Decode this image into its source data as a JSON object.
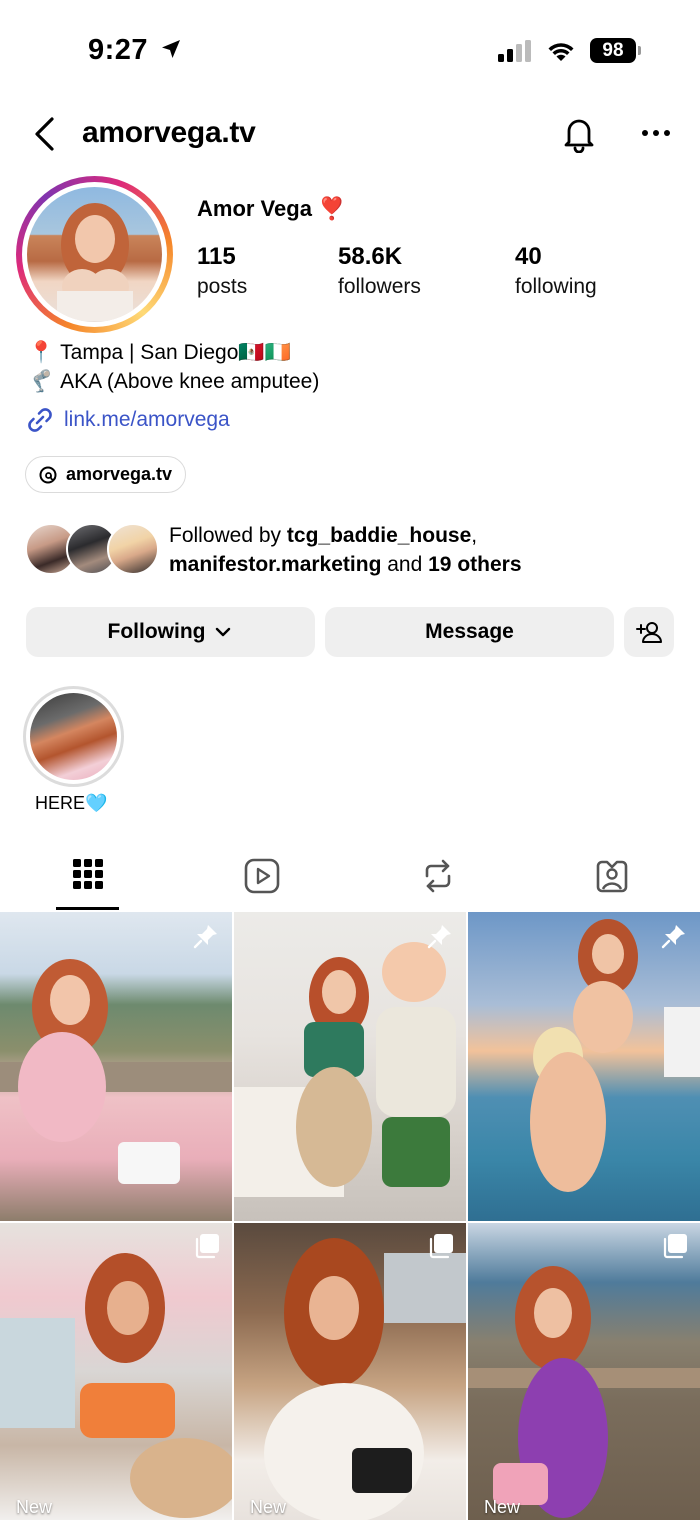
{
  "status_bar": {
    "time": "9:27",
    "battery": "98"
  },
  "header": {
    "username": "amorvega.tv"
  },
  "profile": {
    "display_name": "Amor Vega ❣️",
    "stats": [
      {
        "value": "115",
        "label": "posts"
      },
      {
        "value": "58.6K",
        "label": "followers"
      },
      {
        "value": "40",
        "label": "following"
      }
    ],
    "bio": [
      {
        "emoji": "📍",
        "text": "Tampa | San Diego🇲🇽🇮🇪"
      },
      {
        "emoji": "🦿",
        "text": "AKA (Above knee amputee)"
      }
    ],
    "link": "link.me/amorvega",
    "threads_handle": "amorvega.tv"
  },
  "followed_by": {
    "prefix": "Followed by ",
    "user1": "tcg_baddie_house",
    "sep": ",",
    "user2": "manifestor.marketing",
    "mid": " and ",
    "others": "19 others"
  },
  "actions": {
    "following_label": "Following",
    "message_label": "Message"
  },
  "highlights": [
    {
      "label": "HERE🩵"
    }
  ],
  "tabs": [
    "grid-icon",
    "reels-icon",
    "reposts-icon",
    "tagged-icon"
  ],
  "grid": [
    {
      "badge": "pin",
      "label": ""
    },
    {
      "badge": "pin",
      "label": ""
    },
    {
      "badge": "pin",
      "label": ""
    },
    {
      "badge": "multi",
      "label": "New"
    },
    {
      "badge": "multi",
      "label": "New"
    },
    {
      "badge": "multi",
      "label": "New"
    }
  ],
  "colors": {
    "link": "#3b54c7",
    "button_bg": "#efefef",
    "ring_start": "#f58529",
    "ring_end": "#dd2a7b"
  }
}
